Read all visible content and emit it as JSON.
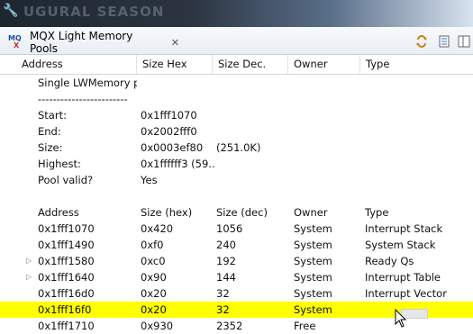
{
  "background": {
    "banner_text": "UGURAL SEASON"
  },
  "view": {
    "tab_title": "MQX Light Memory Pools",
    "tab_icon_text_top": "MQ",
    "tab_icon_text_bottom": "X"
  },
  "columns": [
    "Address",
    "Size Hex",
    "Size Dec.",
    "Owner",
    "Type"
  ],
  "summary": {
    "title": "Single LWMemory po",
    "separator": "------------------------",
    "fields": [
      {
        "label": "Start:",
        "value": "0x1fff1070",
        "extra": ""
      },
      {
        "label": "End:",
        "value": "0x2002fff0",
        "extra": ""
      },
      {
        "label": "Size:",
        "value": "0x0003ef80",
        "extra": "(251.0K)"
      },
      {
        "label": "Highest:",
        "value": "0x1ffffff3 (59...",
        "extra": ""
      },
      {
        "label": "Pool valid?",
        "value": "Yes",
        "extra": ""
      }
    ]
  },
  "blocks_header": {
    "address": "Address",
    "size_hex": "Size (hex)",
    "size_dec": "Size (dec)",
    "owner": "Owner",
    "type": "Type"
  },
  "blocks": [
    {
      "address": "0x1fff1070",
      "size_hex": "0x420",
      "size_dec": "1056",
      "owner": "System",
      "type": "Interrupt Stack",
      "expandable": false,
      "highlighted": false
    },
    {
      "address": "0x1fff1490",
      "size_hex": "0xf0",
      "size_dec": "240",
      "owner": "System",
      "type": "System Stack",
      "expandable": false,
      "highlighted": false
    },
    {
      "address": "0x1fff1580",
      "size_hex": "0xc0",
      "size_dec": "192",
      "owner": "System",
      "type": "Ready Qs",
      "expandable": true,
      "highlighted": false
    },
    {
      "address": "0x1fff1640",
      "size_hex": "0x90",
      "size_dec": "144",
      "owner": "System",
      "type": "Interrupt Table",
      "expandable": true,
      "highlighted": false
    },
    {
      "address": "0x1fff16d0",
      "size_hex": "0x20",
      "size_dec": "32",
      "owner": "System",
      "type": "Interrupt Vector",
      "expandable": false,
      "highlighted": false
    },
    {
      "address": "0x1fff16f0",
      "size_hex": "0x20",
      "size_dec": "32",
      "owner": "System",
      "type": "",
      "expandable": false,
      "highlighted": true
    },
    {
      "address": "0x1fff1710",
      "size_hex": "0x930",
      "size_dec": "2352",
      "owner": "Free",
      "type": "",
      "expandable": false,
      "highlighted": false
    }
  ],
  "colors": {
    "highlight": "#ffff00",
    "header_border": "#d6d6d6"
  }
}
